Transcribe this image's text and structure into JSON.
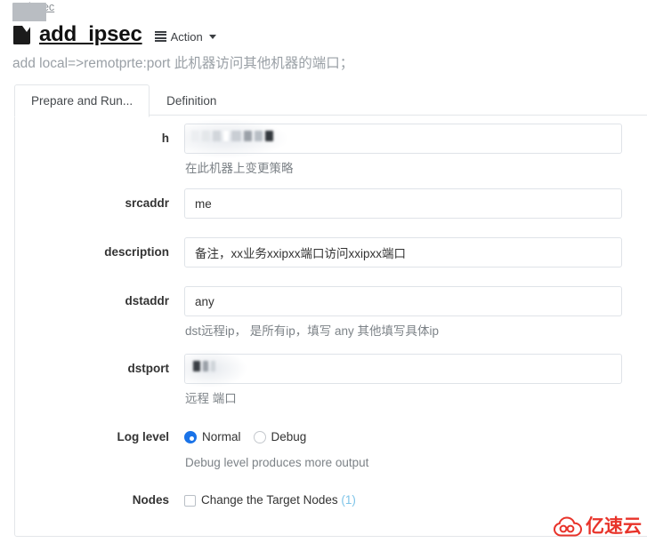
{
  "breadcrumb": {
    "icon": "folder-icon",
    "label": "ipsec"
  },
  "header": {
    "icon": "book-icon",
    "title": "add_ipsec",
    "action_label": "Action",
    "action_icon": "list-icon",
    "caret_icon": "chevron-down-icon"
  },
  "subtitle": "add local=>remotprte:port 此机器访问其他机器的端口；",
  "tabs": [
    {
      "label": "Prepare and Run...",
      "active": true
    },
    {
      "label": "Definition",
      "active": false
    }
  ],
  "form": {
    "fields": [
      {
        "label": "h",
        "value": "",
        "redacted": true,
        "help": "在此机器上变更策略"
      },
      {
        "label": "srcaddr",
        "value": "me",
        "redacted": false,
        "help": ""
      },
      {
        "label": "description",
        "value": "备注，xx业务xxipxx端口访问xxipxx端口",
        "redacted": false,
        "help": ""
      },
      {
        "label": "dstaddr",
        "value": "any",
        "redacted": false,
        "help": "dst远程ip， 是所有ip，填写 any 其他填写具体ip"
      },
      {
        "label": "dstport",
        "value": "",
        "redacted": true,
        "help": "远程 端口"
      }
    ],
    "log_level": {
      "label": "Log level",
      "options": [
        {
          "label": "Normal",
          "selected": true
        },
        {
          "label": "Debug",
          "selected": false
        }
      ],
      "help": "Debug level produces more output"
    },
    "nodes": {
      "label": "Nodes",
      "checkbox_label": "Change the Target Nodes",
      "count": "(1)",
      "checked": false
    }
  },
  "watermark": {
    "text": "亿速云",
    "color": "#e8332a"
  },
  "colors": {
    "accent": "#1a73e8",
    "border": "#e3e6e9",
    "input_border": "#dfe3e8",
    "muted_text": "#9aa0a6",
    "link_blue": "#7ec4e8"
  }
}
